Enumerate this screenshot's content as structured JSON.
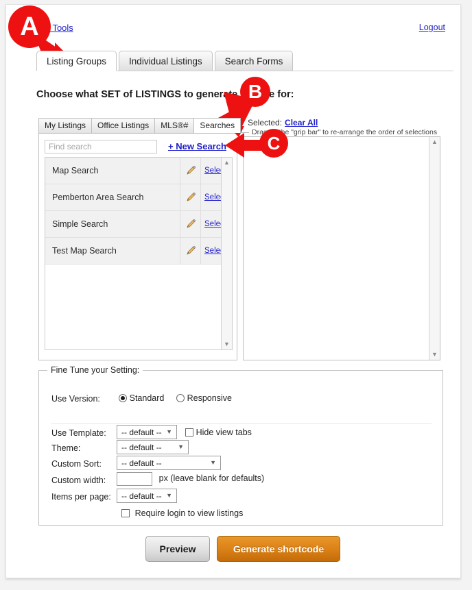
{
  "header": {
    "admin_link": "...g Tools",
    "logout_link": "Logout"
  },
  "main_tabs": [
    {
      "label": "Listing Groups",
      "active": true
    },
    {
      "label": "Individual Listings",
      "active": false
    },
    {
      "label": "Search Forms",
      "active": false
    }
  ],
  "heading": "Choose what SET of LISTINGS to generate the ... e for:",
  "sub_tabs": [
    {
      "label": "My Listings",
      "active": false
    },
    {
      "label": "Office Listings",
      "active": false
    },
    {
      "label": "MLS®#",
      "active": false
    },
    {
      "label": "Searches",
      "active": true
    }
  ],
  "search_panel": {
    "find_placeholder": "Find search",
    "find_value": "",
    "new_search_label": "+ New Search",
    "rows": [
      {
        "name": "Map Search",
        "edit_icon": "pencil-icon",
        "select_label": "Select »"
      },
      {
        "name": "Pemberton Area Search",
        "edit_icon": "pencil-icon",
        "select_label": "Select »"
      },
      {
        "name": "Simple Search",
        "edit_icon": "pencil-icon",
        "select_label": "Select »"
      },
      {
        "name": "Test Map Search",
        "edit_icon": "pencil-icon",
        "select_label": "Select »"
      }
    ]
  },
  "selected_panel": {
    "label": "Selected:",
    "clear_all_label": "Clear All",
    "drag_note": "Drag by the \"grip bar\" to re-arrange the order of selections",
    "items": []
  },
  "fine_tune": {
    "legend": "Fine Tune your Setting:",
    "use_version": {
      "label": "Use Version:",
      "options": [
        {
          "label": "Standard",
          "selected": true
        },
        {
          "label": "Responsive",
          "selected": false
        }
      ]
    },
    "use_template": {
      "label": "Use Template:",
      "value": "-- default --"
    },
    "hide_view_tabs": {
      "label": "Hide view tabs",
      "checked": false
    },
    "theme": {
      "label": "Theme:",
      "value": "-- default --"
    },
    "custom_sort": {
      "label": "Custom Sort:",
      "value": "-- default --"
    },
    "custom_width": {
      "label": "Custom width:",
      "value": "",
      "suffix": "px (leave blank for defaults)"
    },
    "items_per_page": {
      "label": "Items per page:",
      "value": "-- default --"
    },
    "require_login": {
      "label": "Require login to view listings",
      "checked": false
    }
  },
  "buttons": {
    "preview": "Preview",
    "generate": "Generate shortcode"
  },
  "annotations": [
    {
      "letter": "A",
      "target": "listing-groups-tab"
    },
    {
      "letter": "B",
      "target": "searches-subtab"
    },
    {
      "letter": "C",
      "target": "new-search-link"
    }
  ],
  "colors": {
    "link": "#2020CC",
    "annotation_red": "#EE1111",
    "generate_orange": "#DD8419"
  }
}
